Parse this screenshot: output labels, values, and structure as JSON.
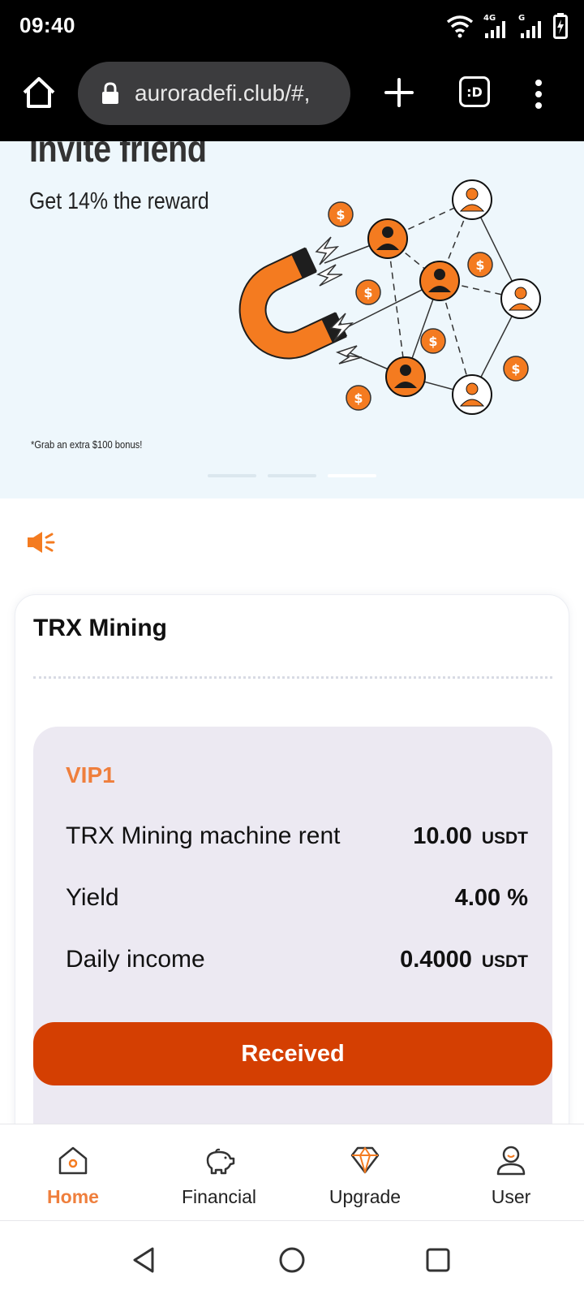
{
  "status_bar": {
    "time": "09:40",
    "icons": [
      "wifi-icon",
      "signal-4g-icon",
      "signal-g-icon",
      "battery-charging-icon"
    ]
  },
  "browser": {
    "url": "auroradefi.club/#,",
    "tabs_label": ":D",
    "icons": [
      "home-icon",
      "lock-icon",
      "plus-icon",
      "tabs-icon",
      "more-vert-icon"
    ]
  },
  "banner": {
    "title": "Invite friend",
    "subtitle": "Get 14% the reward",
    "note": "*Grab an extra $100 bonus!",
    "slides": 3,
    "active_slide": 2,
    "colors": {
      "accent": "#f47b20",
      "background": "#eef7fc"
    }
  },
  "announcement": {
    "icon": "speaker-icon"
  },
  "mining": {
    "title": "TRX Mining",
    "plan": {
      "level": "VIP1",
      "rows": [
        {
          "label": "TRX Mining machine rent",
          "value": "10.00",
          "unit": "USDT"
        },
        {
          "label": "Yield",
          "value": "4.00 %",
          "unit": ""
        },
        {
          "label": "Daily income",
          "value": "0.4000",
          "unit": "USDT"
        }
      ],
      "button": "Received"
    },
    "colors": {
      "button": "#d43f02",
      "vip": "#ef7f3d"
    }
  },
  "bottom_nav": {
    "active": "Home",
    "items": [
      {
        "label": "Home",
        "icon": "home-icon"
      },
      {
        "label": "Financial",
        "icon": "piggy-bank-icon"
      },
      {
        "label": "Upgrade",
        "icon": "diamond-icon"
      },
      {
        "label": "User",
        "icon": "user-icon"
      }
    ]
  },
  "system_nav": {
    "icons": [
      "back-icon",
      "home-circle-icon",
      "recents-icon"
    ]
  }
}
